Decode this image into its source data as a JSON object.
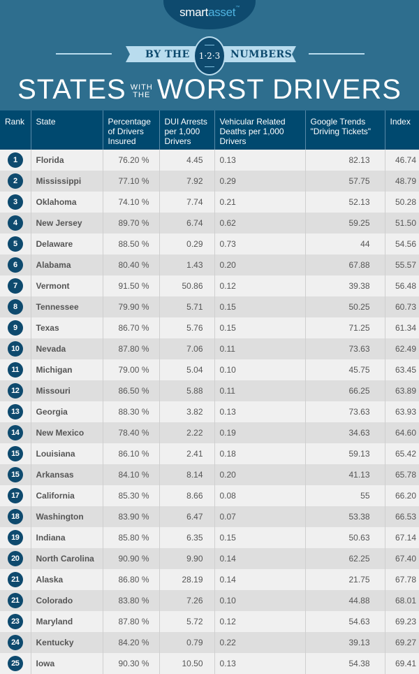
{
  "brand": {
    "logo_main": "smart",
    "logo_accent": "asset",
    "logo_tm": "™",
    "colors": {
      "background": "#2e6e8e",
      "navy": "#0e4a6e",
      "header": "#00496f",
      "ribbon": "#b9dcee",
      "accent": "#4fb3e0"
    }
  },
  "banner": {
    "left": "BY THE",
    "badge": "1·2·3",
    "right": "NUMBERS"
  },
  "title": {
    "part1": "STATES",
    "small_top": "WITH",
    "small_bottom": "THE",
    "part2": "WORST DRIVERS"
  },
  "table": {
    "columns": [
      "Rank",
      "State",
      "Percentage of Drivers Insured",
      "DUI Arrests per 1,000 Drivers",
      "Vehicular Related Deaths per 1,000 Drivers",
      "Google Trends \"Driving Tickets\"",
      "Index"
    ],
    "rows": [
      {
        "rank": "1",
        "state": "Florida",
        "pct": "76.20 %",
        "dui": "4.45",
        "deaths": "0.13",
        "trends": "82.13",
        "index": "46.74"
      },
      {
        "rank": "2",
        "state": "Mississippi",
        "pct": "77.10 %",
        "dui": "7.92",
        "deaths": "0.29",
        "trends": "57.75",
        "index": "48.79"
      },
      {
        "rank": "3",
        "state": "Oklahoma",
        "pct": "74.10 %",
        "dui": "7.74",
        "deaths": "0.21",
        "trends": "52.13",
        "index": "50.28"
      },
      {
        "rank": "4",
        "state": "New Jersey",
        "pct": "89.70 %",
        "dui": "6.74",
        "deaths": "0.62",
        "trends": "59.25",
        "index": "51.50"
      },
      {
        "rank": "5",
        "state": "Delaware",
        "pct": "88.50 %",
        "dui": "0.29",
        "deaths": "0.73",
        "trends": "44",
        "index": "54.56"
      },
      {
        "rank": "6",
        "state": "Alabama",
        "pct": "80.40 %",
        "dui": "1.43",
        "deaths": "0.20",
        "trends": "67.88",
        "index": "55.57"
      },
      {
        "rank": "7",
        "state": "Vermont",
        "pct": "91.50 %",
        "dui": "50.86",
        "deaths": "0.12",
        "trends": "39.38",
        "index": "56.48"
      },
      {
        "rank": "8",
        "state": "Tennessee",
        "pct": "79.90 %",
        "dui": "5.71",
        "deaths": "0.15",
        "trends": "50.25",
        "index": "60.73"
      },
      {
        "rank": "9",
        "state": "Texas",
        "pct": "86.70 %",
        "dui": "5.76",
        "deaths": "0.15",
        "trends": "71.25",
        "index": "61.34"
      },
      {
        "rank": "10",
        "state": "Nevada",
        "pct": "87.80 %",
        "dui": "7.06",
        "deaths": "0.11",
        "trends": "73.63",
        "index": "62.49"
      },
      {
        "rank": "11",
        "state": "Michigan",
        "pct": "79.00 %",
        "dui": "5.04",
        "deaths": "0.10",
        "trends": "45.75",
        "index": "63.45"
      },
      {
        "rank": "12",
        "state": "Missouri",
        "pct": "86.50 %",
        "dui": "5.88",
        "deaths": "0.11",
        "trends": "66.25",
        "index": "63.89"
      },
      {
        "rank": "13",
        "state": "Georgia",
        "pct": "88.30 %",
        "dui": "3.82",
        "deaths": "0.13",
        "trends": "73.63",
        "index": "63.93"
      },
      {
        "rank": "14",
        "state": "New Mexico",
        "pct": "78.40 %",
        "dui": "2.22",
        "deaths": "0.19",
        "trends": "34.63",
        "index": "64.60"
      },
      {
        "rank": "15",
        "state": "Louisiana",
        "pct": "86.10 %",
        "dui": "2.41",
        "deaths": "0.18",
        "trends": "59.13",
        "index": "65.42"
      },
      {
        "rank": "15",
        "state": "Arkansas",
        "pct": "84.10 %",
        "dui": "8.14",
        "deaths": "0.20",
        "trends": "41.13",
        "index": "65.78"
      },
      {
        "rank": "17",
        "state": "California",
        "pct": "85.30 %",
        "dui": "8.66",
        "deaths": "0.08",
        "trends": "55",
        "index": "66.20"
      },
      {
        "rank": "18",
        "state": "Washington",
        "pct": "83.90 %",
        "dui": "6.47",
        "deaths": "0.07",
        "trends": "53.38",
        "index": "66.53"
      },
      {
        "rank": "19",
        "state": "Indiana",
        "pct": "85.80 %",
        "dui": "6.35",
        "deaths": "0.15",
        "trends": "50.63",
        "index": "67.14"
      },
      {
        "rank": "20",
        "state": "North Carolina",
        "pct": "90.90 %",
        "dui": "9.90",
        "deaths": "0.14",
        "trends": "62.25",
        "index": "67.40"
      },
      {
        "rank": "21",
        "state": "Alaska",
        "pct": "86.80 %",
        "dui": "28.19",
        "deaths": "0.14",
        "trends": "21.75",
        "index": "67.78"
      },
      {
        "rank": "21",
        "state": "Colorado",
        "pct": "83.80 %",
        "dui": "7.26",
        "deaths": "0.10",
        "trends": "44.88",
        "index": "68.01"
      },
      {
        "rank": "23",
        "state": "Maryland",
        "pct": "87.80 %",
        "dui": "5.72",
        "deaths": "0.12",
        "trends": "54.63",
        "index": "69.23"
      },
      {
        "rank": "24",
        "state": "Kentucky",
        "pct": "84.20 %",
        "dui": "0.79",
        "deaths": "0.22",
        "trends": "39.13",
        "index": "69.27"
      },
      {
        "rank": "25",
        "state": "Iowa",
        "pct": "90.30 %",
        "dui": "10.50",
        "deaths": "0.13",
        "trends": "54.38",
        "index": "69.41"
      }
    ]
  }
}
